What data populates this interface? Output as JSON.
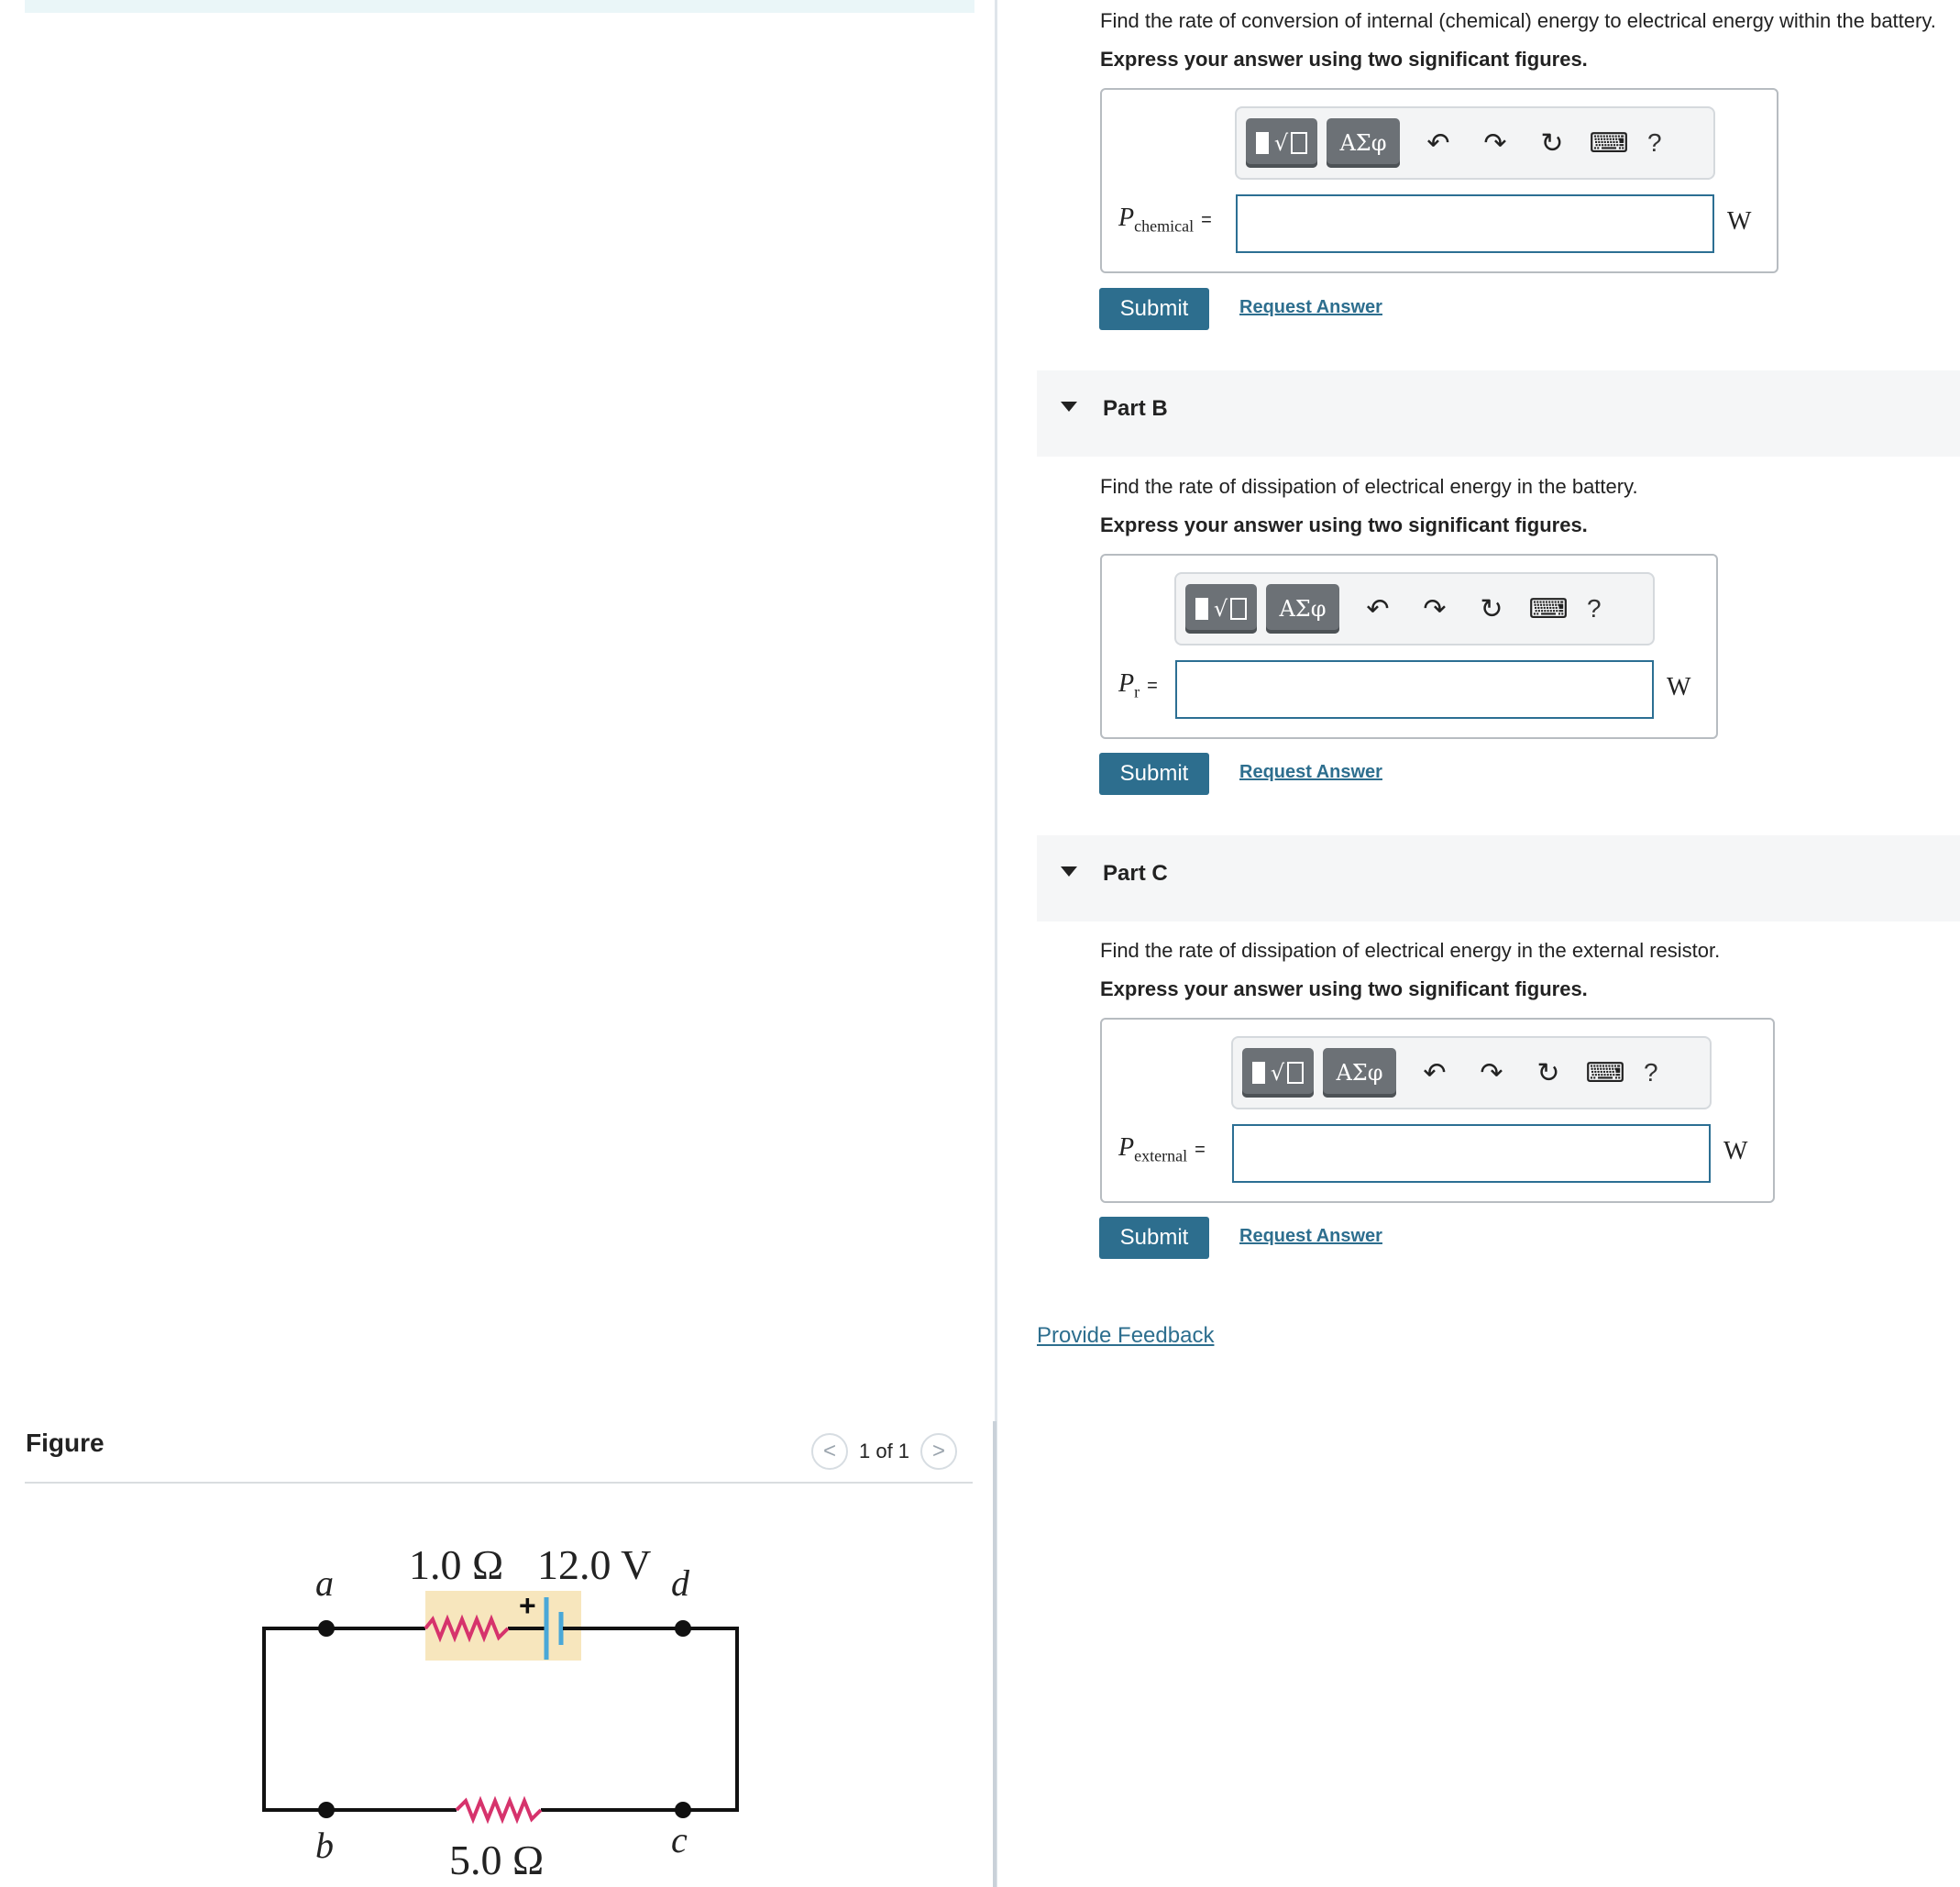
{
  "figure": {
    "title": "Figure",
    "pager_text": "1 of 1",
    "prev_glyph": "<",
    "next_glyph": ">",
    "labels": {
      "node_a": "a",
      "node_b": "b",
      "node_c": "c",
      "node_d": "d",
      "internal_resistance": "1.0 Ω",
      "emf": "12.0 V",
      "external_resistance": "5.0 Ω",
      "plus": "+"
    },
    "colors": {
      "resistor": "#d6336c",
      "battery": "#4aa8d8",
      "highlight": "#f7e6bd"
    }
  },
  "part_a": {
    "question": "Find the rate of conversion of internal (chemical) energy to electrical energy within the battery.",
    "instruction": "Express your answer using two significant figures.",
    "var_main": "P",
    "var_sub": "chemical",
    "eq": "=",
    "unit": "W",
    "input_value": "",
    "submit": "Submit",
    "request": "Request Answer"
  },
  "part_b": {
    "header": "Part B",
    "question": "Find the rate of dissipation of electrical energy in the battery.",
    "instruction": "Express your answer using two significant figures.",
    "var_main": "P",
    "var_sub": "r",
    "eq": "=",
    "unit": "W",
    "input_value": "",
    "submit": "Submit",
    "request": "Request Answer"
  },
  "part_c": {
    "header": "Part C",
    "question": "Find the rate of dissipation of electrical energy in the external resistor.",
    "instruction": "Express your answer using two significant figures.",
    "var_main": "P",
    "var_sub": "external",
    "eq": "=",
    "unit": "W",
    "input_value": "",
    "submit": "Submit",
    "request": "Request Answer"
  },
  "toolbar": {
    "greek": "ΑΣφ",
    "templates": "√",
    "help": "?",
    "undo": "↶",
    "redo": "↷",
    "reset": "↻",
    "keyboard": "⌨"
  },
  "feedback": "Provide Feedback"
}
